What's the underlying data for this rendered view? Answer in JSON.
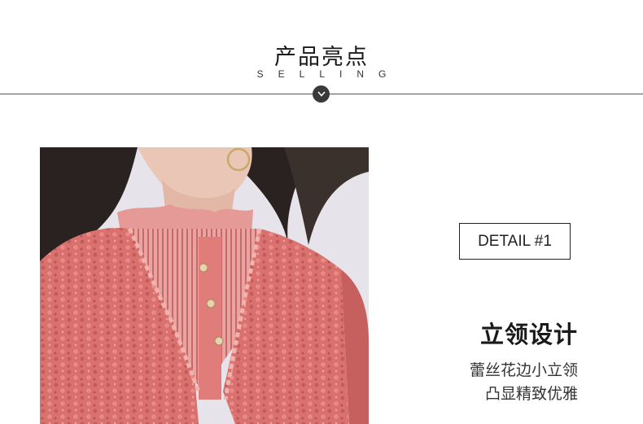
{
  "header": {
    "title": "产品亮点",
    "subtitle": "SELLING",
    "badge_icon": "chevron-down-icon"
  },
  "detail": {
    "label": "DETAIL #1",
    "title": "立领设计",
    "lines": [
      "蕾丝花边小立领",
      "凸显精致优雅"
    ]
  },
  "product_image": {
    "description_icon": "product-photo",
    "colors": {
      "lace": "#d9726f",
      "background": "#e6e3ea",
      "hair": "#2a2220"
    }
  }
}
